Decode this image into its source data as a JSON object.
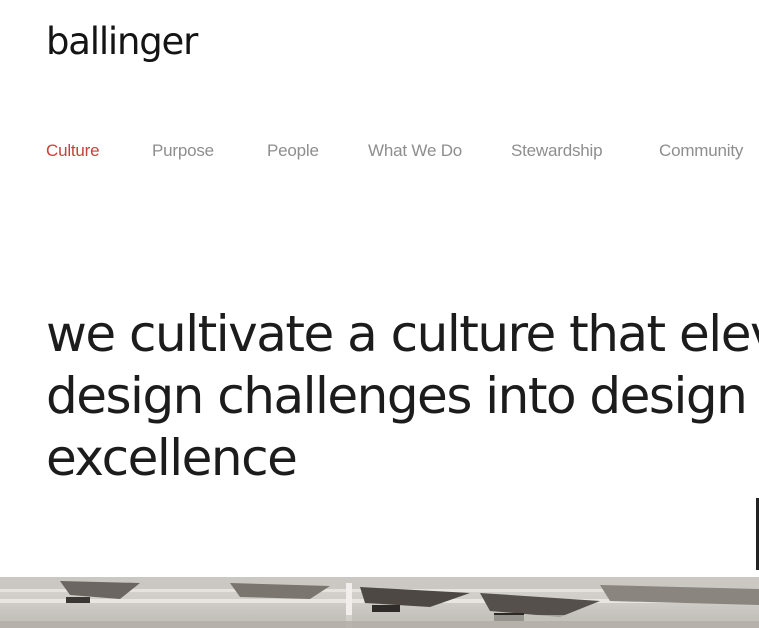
{
  "brand": {
    "logo_text": "ballinger"
  },
  "nav": {
    "items": [
      {
        "label": "Culture",
        "active": true
      },
      {
        "label": "Purpose",
        "active": false
      },
      {
        "label": "People",
        "active": false
      },
      {
        "label": "What We Do",
        "active": false
      },
      {
        "label": "Stewardship",
        "active": false
      },
      {
        "label": "Community",
        "active": false
      }
    ]
  },
  "hero": {
    "lines": [
      "we cultivate a culture that eleva",
      "design challenges into design",
      "excellence"
    ]
  },
  "colors": {
    "accent": "#c8413a",
    "nav_text": "#8e8e8e",
    "heading": "#1c1c1c"
  }
}
